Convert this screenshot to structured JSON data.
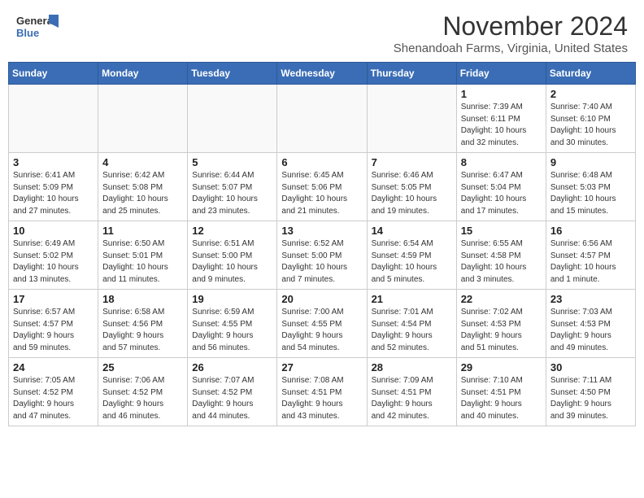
{
  "header": {
    "logo_line1": "General",
    "logo_line2": "Blue",
    "month": "November 2024",
    "location": "Shenandoah Farms, Virginia, United States"
  },
  "weekdays": [
    "Sunday",
    "Monday",
    "Tuesday",
    "Wednesday",
    "Thursday",
    "Friday",
    "Saturday"
  ],
  "weeks": [
    [
      {
        "day": "",
        "info": ""
      },
      {
        "day": "",
        "info": ""
      },
      {
        "day": "",
        "info": ""
      },
      {
        "day": "",
        "info": ""
      },
      {
        "day": "",
        "info": ""
      },
      {
        "day": "1",
        "info": "Sunrise: 7:39 AM\nSunset: 6:11 PM\nDaylight: 10 hours\nand 32 minutes."
      },
      {
        "day": "2",
        "info": "Sunrise: 7:40 AM\nSunset: 6:10 PM\nDaylight: 10 hours\nand 30 minutes."
      }
    ],
    [
      {
        "day": "3",
        "info": "Sunrise: 6:41 AM\nSunset: 5:09 PM\nDaylight: 10 hours\nand 27 minutes."
      },
      {
        "day": "4",
        "info": "Sunrise: 6:42 AM\nSunset: 5:08 PM\nDaylight: 10 hours\nand 25 minutes."
      },
      {
        "day": "5",
        "info": "Sunrise: 6:44 AM\nSunset: 5:07 PM\nDaylight: 10 hours\nand 23 minutes."
      },
      {
        "day": "6",
        "info": "Sunrise: 6:45 AM\nSunset: 5:06 PM\nDaylight: 10 hours\nand 21 minutes."
      },
      {
        "day": "7",
        "info": "Sunrise: 6:46 AM\nSunset: 5:05 PM\nDaylight: 10 hours\nand 19 minutes."
      },
      {
        "day": "8",
        "info": "Sunrise: 6:47 AM\nSunset: 5:04 PM\nDaylight: 10 hours\nand 17 minutes."
      },
      {
        "day": "9",
        "info": "Sunrise: 6:48 AM\nSunset: 5:03 PM\nDaylight: 10 hours\nand 15 minutes."
      }
    ],
    [
      {
        "day": "10",
        "info": "Sunrise: 6:49 AM\nSunset: 5:02 PM\nDaylight: 10 hours\nand 13 minutes."
      },
      {
        "day": "11",
        "info": "Sunrise: 6:50 AM\nSunset: 5:01 PM\nDaylight: 10 hours\nand 11 minutes."
      },
      {
        "day": "12",
        "info": "Sunrise: 6:51 AM\nSunset: 5:00 PM\nDaylight: 10 hours\nand 9 minutes."
      },
      {
        "day": "13",
        "info": "Sunrise: 6:52 AM\nSunset: 5:00 PM\nDaylight: 10 hours\nand 7 minutes."
      },
      {
        "day": "14",
        "info": "Sunrise: 6:54 AM\nSunset: 4:59 PM\nDaylight: 10 hours\nand 5 minutes."
      },
      {
        "day": "15",
        "info": "Sunrise: 6:55 AM\nSunset: 4:58 PM\nDaylight: 10 hours\nand 3 minutes."
      },
      {
        "day": "16",
        "info": "Sunrise: 6:56 AM\nSunset: 4:57 PM\nDaylight: 10 hours\nand 1 minute."
      }
    ],
    [
      {
        "day": "17",
        "info": "Sunrise: 6:57 AM\nSunset: 4:57 PM\nDaylight: 9 hours\nand 59 minutes."
      },
      {
        "day": "18",
        "info": "Sunrise: 6:58 AM\nSunset: 4:56 PM\nDaylight: 9 hours\nand 57 minutes."
      },
      {
        "day": "19",
        "info": "Sunrise: 6:59 AM\nSunset: 4:55 PM\nDaylight: 9 hours\nand 56 minutes."
      },
      {
        "day": "20",
        "info": "Sunrise: 7:00 AM\nSunset: 4:55 PM\nDaylight: 9 hours\nand 54 minutes."
      },
      {
        "day": "21",
        "info": "Sunrise: 7:01 AM\nSunset: 4:54 PM\nDaylight: 9 hours\nand 52 minutes."
      },
      {
        "day": "22",
        "info": "Sunrise: 7:02 AM\nSunset: 4:53 PM\nDaylight: 9 hours\nand 51 minutes."
      },
      {
        "day": "23",
        "info": "Sunrise: 7:03 AM\nSunset: 4:53 PM\nDaylight: 9 hours\nand 49 minutes."
      }
    ],
    [
      {
        "day": "24",
        "info": "Sunrise: 7:05 AM\nSunset: 4:52 PM\nDaylight: 9 hours\nand 47 minutes."
      },
      {
        "day": "25",
        "info": "Sunrise: 7:06 AM\nSunset: 4:52 PM\nDaylight: 9 hours\nand 46 minutes."
      },
      {
        "day": "26",
        "info": "Sunrise: 7:07 AM\nSunset: 4:52 PM\nDaylight: 9 hours\nand 44 minutes."
      },
      {
        "day": "27",
        "info": "Sunrise: 7:08 AM\nSunset: 4:51 PM\nDaylight: 9 hours\nand 43 minutes."
      },
      {
        "day": "28",
        "info": "Sunrise: 7:09 AM\nSunset: 4:51 PM\nDaylight: 9 hours\nand 42 minutes."
      },
      {
        "day": "29",
        "info": "Sunrise: 7:10 AM\nSunset: 4:51 PM\nDaylight: 9 hours\nand 40 minutes."
      },
      {
        "day": "30",
        "info": "Sunrise: 7:11 AM\nSunset: 4:50 PM\nDaylight: 9 hours\nand 39 minutes."
      }
    ]
  ]
}
